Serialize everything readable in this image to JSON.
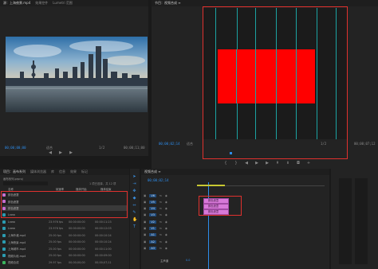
{
  "source_monitor": {
    "tabs": [
      "源：上海夜景.mp4",
      "效果控件",
      "Lumetri 范围"
    ],
    "timecode_in": "00;00;00;00",
    "fit": "适合",
    "zoom": "1/2",
    "timecode_out": "00;00;11;00"
  },
  "program_monitor": {
    "tabs": [
      "节目：视频合成 ≡"
    ],
    "timecode": "00;00;02;14",
    "fit": "适合",
    "zoom": "1/2",
    "duration": "00;00;07;12",
    "red_rect_color": "#ff0000",
    "guide_color": "#1ba3a3"
  },
  "project": {
    "tabs": [
      "项目：画布系列",
      "媒体浏览器",
      "库",
      "信息",
      "效果",
      "标记"
    ],
    "file": "画布系列.prproj",
    "search_placeholder": "",
    "count": "1 项已选择，共 12 项",
    "columns": [
      "名称",
      "帧速率",
      "媒体开始",
      "媒体结束"
    ],
    "rows": [
      {
        "name": "颜色遮罩",
        "fps": "",
        "start": "",
        "end": "",
        "swatch": "#c86ecf",
        "selected": false
      },
      {
        "name": "颜色遮罩",
        "fps": "",
        "start": "",
        "end": "",
        "swatch": "#c86ecf",
        "selected": false
      },
      {
        "name": "颜色遮罩",
        "fps": "",
        "start": "",
        "end": "",
        "swatch": "#c86ecf",
        "selected": true
      },
      {
        "name": "Lnew",
        "fps": "",
        "start": "",
        "end": "",
        "swatch": "#2b9bb0",
        "selected": false
      },
      {
        "name": "Lnew",
        "fps": "23.976 fps",
        "start": "00:00:00:00",
        "end": "00:00:11:23",
        "swatch": "#2b9bb0",
        "selected": false
      },
      {
        "name": "Lnew",
        "fps": "23.976 fps",
        "start": "00:00:00:00",
        "end": "00:00:12:03",
        "swatch": "#2b9bb0",
        "selected": false
      },
      {
        "name": "上海外滩.mp4",
        "fps": "25.00 fps",
        "start": "00:00:00:00",
        "end": "00:00:10:24",
        "swatch": "#2b9bb0",
        "selected": false
      },
      {
        "name": "上海夜景.mp4",
        "fps": "25.00 fps",
        "start": "00:00:00:00",
        "end": "00:00:10:24",
        "swatch": "#2b9bb0",
        "selected": false
      },
      {
        "name": "上海城市.mp4",
        "fps": "25.00 fps",
        "start": "00:00:00:00",
        "end": "00:00:11:00",
        "swatch": "#2b9bb0",
        "selected": false
      },
      {
        "name": "视频片段.mp4",
        "fps": "25.00 fps",
        "start": "00:00:00:00",
        "end": "00:00:09:00",
        "swatch": "#2b9bb0",
        "selected": false
      },
      {
        "name": "视频合成",
        "fps": "29.97 fps",
        "start": "00;00;00;00",
        "end": "00;00;07;11",
        "swatch": "#3bb55e",
        "selected": false
      }
    ]
  },
  "timeline": {
    "tab": "视频合成 ≡",
    "timecode": "00;00;02;14",
    "tracks": [
      {
        "id": "V6",
        "locked": true
      },
      {
        "id": "V5",
        "locked": true
      },
      {
        "id": "V4",
        "locked": true
      },
      {
        "id": "V3",
        "locked": true
      },
      {
        "id": "V2",
        "locked": true
      },
      {
        "id": "V1",
        "locked": true
      },
      {
        "id": "A1",
        "locked": true
      },
      {
        "id": "A2",
        "locked": true
      },
      {
        "id": "A3",
        "locked": true
      }
    ],
    "clips": [
      "颜色遮罩",
      "颜色遮罩",
      "颜色遮罩"
    ],
    "master": "主声道",
    "master_value": "0.0"
  },
  "tools": [
    "select",
    "track-select",
    "ripple",
    "razor",
    "slip",
    "pen",
    "hand",
    "type"
  ],
  "accent": "#2d8ceb",
  "highlight_red": "#e0312e"
}
